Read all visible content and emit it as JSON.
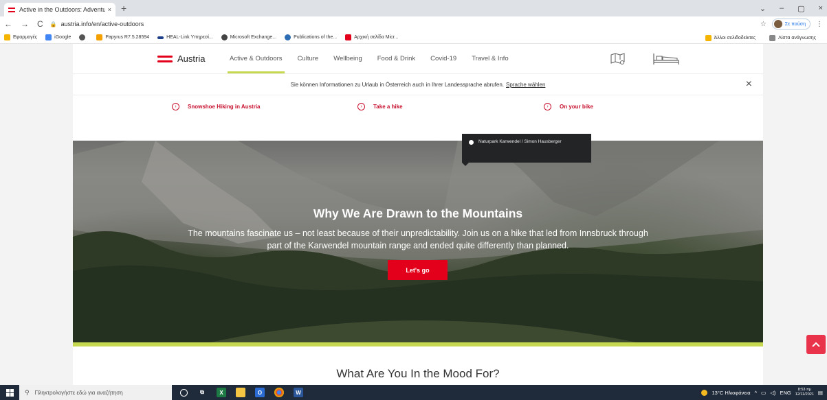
{
  "browser": {
    "tab_title": "Active in the Outdoors: Adventu",
    "tab_close": "×",
    "new_tab": "+",
    "window_controls": [
      "⌄",
      "–",
      "▢",
      "×"
    ],
    "url": "austria.info/en/active-outdoors",
    "profile_label": "Σε παύση",
    "bookmarks": [
      {
        "label": "Εφαρμογές",
        "color": "#e8eaed"
      },
      {
        "label": "iGoogle",
        "color": "#4285f4"
      },
      {
        "label": "",
        "color": "#555"
      },
      {
        "label": "Papyrus R7.5.28594",
        "color": "#f4a100"
      },
      {
        "label": "HEAL-Link Υπηρεσί...",
        "color": "#1d3f8a"
      },
      {
        "label": "Microsoft Exchange...",
        "color": "#444"
      },
      {
        "label": "Publications of the...",
        "color": "#2e6db4"
      },
      {
        "label": "Αρχική σελίδα Micr...",
        "color": "#e2001a"
      }
    ],
    "bookmarks_right": [
      "Άλλοι σελιδοδείκτες",
      "Λίστα ανάγνωσης"
    ]
  },
  "site": {
    "logo_text": "Austria",
    "menu": [
      {
        "label": "Active & Outdoors",
        "active": true
      },
      {
        "label": "Culture",
        "active": false
      },
      {
        "label": "Wellbeing",
        "active": false
      },
      {
        "label": "Food & Drink",
        "active": false
      },
      {
        "label": "Covid-19",
        "active": false
      },
      {
        "label": "Travel & Info",
        "active": false
      }
    ],
    "lang_banner_text": "Sie können Informationen zu Urlaub in Österreich auch in Ihrer Landessprache abrufen.",
    "lang_banner_link": "Sprache wählen",
    "lang_close": "×",
    "quick_links": [
      "Snowshoe Hiking in Austria",
      "Take a hike",
      "On your bike"
    ],
    "hero": {
      "photo_credit": "Naturpark Karwendel / Simon Hausberger",
      "title": "Why We Are Drawn to the Mountains",
      "text": "The mountains fascinate us – not least because of their unpredictability. Join us on a hike that led from Innsbruck through part of the Karwendel mountain range and ended quite differently than planned.",
      "button": "Let's go"
    },
    "section_title": "What Are You In the Mood For?",
    "accent_red": "#e2001a",
    "accent_green": "#c5d84f"
  },
  "taskbar": {
    "search_placeholder": "Πληκτρολογήστε εδώ για αναζήτηση",
    "weather": "13°C Ηλιοφάνεια",
    "language": "ENG",
    "time": "8:53 πμ",
    "date": "12/11/2021"
  }
}
